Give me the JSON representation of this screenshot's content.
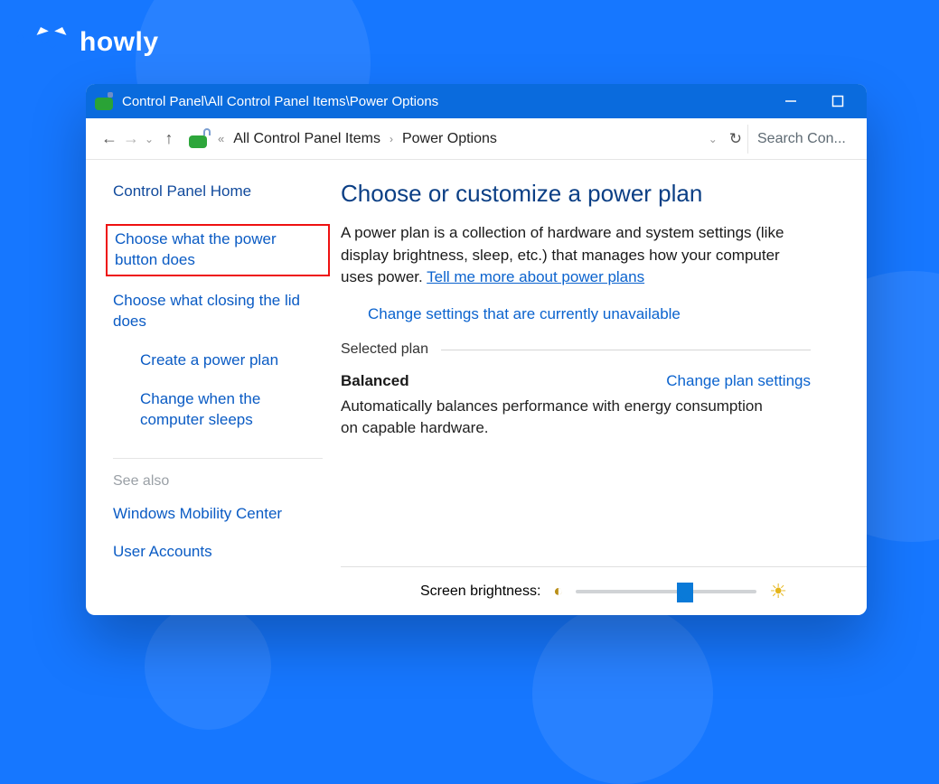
{
  "brand": {
    "name": "howly"
  },
  "titlebar": {
    "path": "Control Panel\\All Control Panel Items\\Power Options"
  },
  "nav": {
    "crumb1": "All Control Panel Items",
    "crumb2": "Power Options",
    "search_placeholder": "Search Con..."
  },
  "sidebar": {
    "home": "Control Panel Home",
    "items": [
      {
        "label": "Choose what the power button does",
        "highlighted": true
      },
      {
        "label": "Choose what closing the lid does"
      },
      {
        "label": "Create a power plan",
        "icon": "shield"
      },
      {
        "label": "Change when the computer sleeps",
        "icon": "moon"
      }
    ],
    "see_also_heading": "See also",
    "see_also": [
      {
        "label": "Windows Mobility Center"
      },
      {
        "label": "User Accounts"
      }
    ]
  },
  "main": {
    "heading": "Choose or customize a power plan",
    "paragraph_lead": "A power plan is a collection of hardware and system settings (like display brightness, sleep, etc.) that manages how your computer uses power. ",
    "paragraph_link": "Tell me more about power plans",
    "change_unavailable": "Change settings that are currently unavailable",
    "selected_plan_heading": "Selected plan",
    "plan_name": "Balanced",
    "change_plan_link": "Change plan settings",
    "plan_description": "Automatically balances performance with energy consumption on capable hardware."
  },
  "footer": {
    "brightness_label": "Screen brightness:",
    "brightness_value_percent": 60
  }
}
